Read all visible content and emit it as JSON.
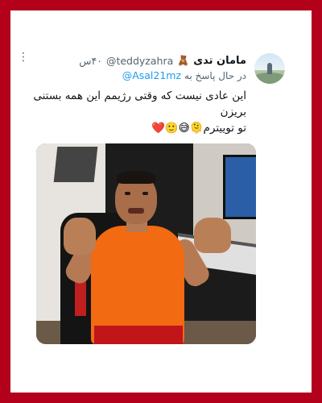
{
  "tweet": {
    "display_name": "مامان تدی",
    "display_emoji": "🧸",
    "handle": "@teddyzahra",
    "time": "۴۰س",
    "reply_prefix": "در حال پاسخ به",
    "reply_mention": "@Asal21mz",
    "text_line1": "این عادی نیست که وقتی رژیمم این همه بستنی بریزن",
    "text_line2": "تو توییترم🫠😅🙂❤️"
  },
  "icons": {
    "more": "more-options-icon",
    "avatar": "avatar"
  },
  "colors": {
    "border": "#b3001b",
    "mention": "#1d9bf0",
    "muted": "#536471",
    "text": "#0f1419"
  }
}
